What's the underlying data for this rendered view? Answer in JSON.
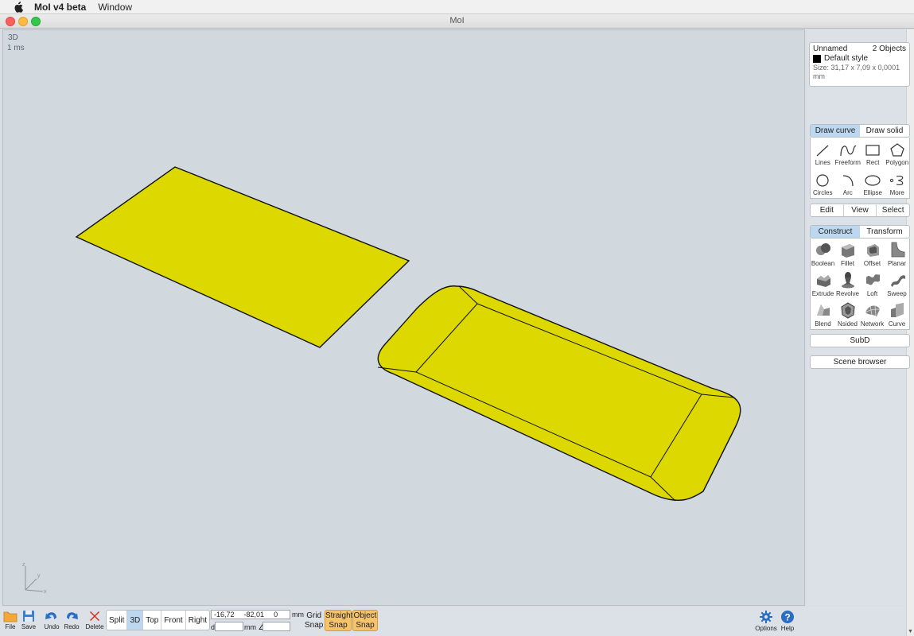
{
  "menubar": {
    "app_name": "MoI v4 beta",
    "menu_window": "Window"
  },
  "window": {
    "title": "MoI"
  },
  "viewport": {
    "label": "3D",
    "timing": "1 ms",
    "axis_z": "z",
    "axis_y": "y",
    "axis_x": "x"
  },
  "scene": {
    "fill_color": "#dcd800",
    "stroke_color": "#111111"
  },
  "info": {
    "name": "Unnamed",
    "object_count": "2 Objects",
    "style": "Default style",
    "size": "Size: 31,17 x 7,09 x 0,0001 mm"
  },
  "draw_tabs": {
    "curve": "Draw curve",
    "solid": "Draw solid"
  },
  "draw_tools": [
    {
      "label": "Lines",
      "icon": "lines-icon"
    },
    {
      "label": "Freeform",
      "icon": "freeform-icon"
    },
    {
      "label": "Rect",
      "icon": "rect-icon"
    },
    {
      "label": "Polygon",
      "icon": "polygon-icon"
    },
    {
      "label": "Circles",
      "icon": "circle-icon"
    },
    {
      "label": "Arc",
      "icon": "arc-icon"
    },
    {
      "label": "Ellipse",
      "icon": "ellipse-icon"
    },
    {
      "label": "More",
      "icon": "more-icon"
    }
  ],
  "mid_tabs": {
    "edit": "Edit",
    "view": "View",
    "select": "Select"
  },
  "construct_tabs": {
    "construct": "Construct",
    "transform": "Transform"
  },
  "construct_tools": [
    {
      "label": "Boolean",
      "icon": "boolean-icon"
    },
    {
      "label": "Fillet",
      "icon": "fillet-icon"
    },
    {
      "label": "Offset",
      "icon": "offset-icon"
    },
    {
      "label": "Planar",
      "icon": "planar-icon"
    },
    {
      "label": "Extrude",
      "icon": "extrude-icon"
    },
    {
      "label": "Revolve",
      "icon": "revolve-icon"
    },
    {
      "label": "Loft",
      "icon": "loft-icon"
    },
    {
      "label": "Sweep",
      "icon": "sweep-icon"
    },
    {
      "label": "Blend",
      "icon": "blend-icon"
    },
    {
      "label": "Nsided",
      "icon": "nsided-icon"
    },
    {
      "label": "Network",
      "icon": "network-icon"
    },
    {
      "label": "Curve",
      "icon": "curve-icon"
    }
  ],
  "buttons": {
    "subd": "SubD",
    "scene_browser": "Scene browser"
  },
  "bottom": {
    "file": "File",
    "save": "Save",
    "undo": "Undo",
    "redo": "Redo",
    "delete": "Delete",
    "views": [
      "Split",
      "3D",
      "Top",
      "Front",
      "Right"
    ],
    "coord_x": "-16,72",
    "coord_y": "-82,01",
    "coord_z": "0",
    "unit_mm": "mm",
    "d_label": "d",
    "angle_label": "mm ∠",
    "grid_snap_1": "Grid",
    "grid_snap_2": "Snap",
    "straight_snap_1": "Straight",
    "straight_snap_2": "Snap",
    "object_snap_1": "Object",
    "object_snap_2": "Snap",
    "options": "Options",
    "help": "Help"
  }
}
